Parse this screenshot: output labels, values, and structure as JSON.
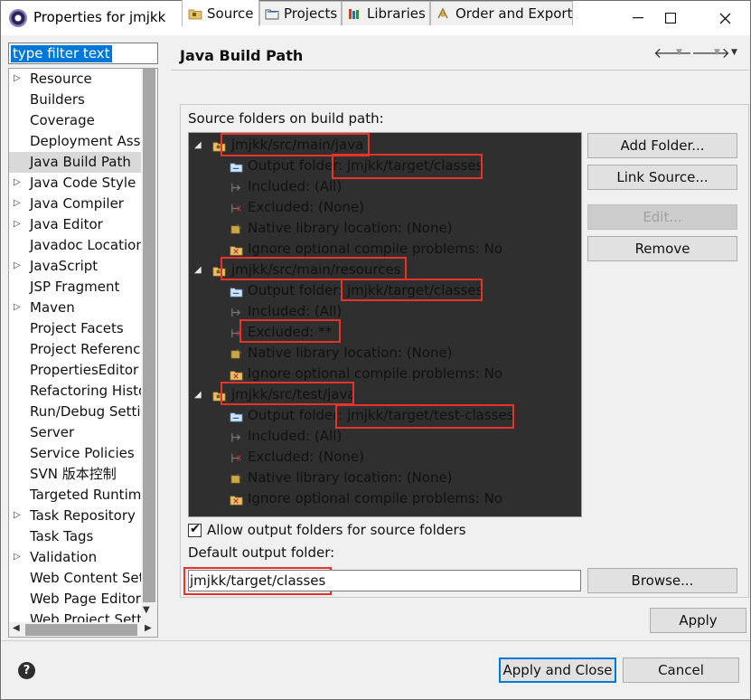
{
  "window": {
    "title": "Properties for jmjkk"
  },
  "filter": {
    "placeholder": "type filter text"
  },
  "nav": {
    "items": [
      {
        "label": "Resource",
        "expandable": true
      },
      {
        "label": "Builders",
        "expandable": false
      },
      {
        "label": "Coverage",
        "expandable": false
      },
      {
        "label": "Deployment Assembly",
        "expandable": false
      },
      {
        "label": "Java Build Path",
        "expandable": false,
        "selected": true
      },
      {
        "label": "Java Code Style",
        "expandable": true
      },
      {
        "label": "Java Compiler",
        "expandable": true
      },
      {
        "label": "Java Editor",
        "expandable": true
      },
      {
        "label": "Javadoc Location",
        "expandable": false
      },
      {
        "label": "JavaScript",
        "expandable": true
      },
      {
        "label": "JSP Fragment",
        "expandable": false
      },
      {
        "label": "Maven",
        "expandable": true
      },
      {
        "label": "Project Facets",
        "expandable": false
      },
      {
        "label": "Project References",
        "expandable": false
      },
      {
        "label": "PropertiesEditor",
        "expandable": false
      },
      {
        "label": "Refactoring History",
        "expandable": false
      },
      {
        "label": "Run/Debug Settings",
        "expandable": false
      },
      {
        "label": "Server",
        "expandable": false
      },
      {
        "label": "Service Policies",
        "expandable": false
      },
      {
        "label": "SVN 版本控制",
        "expandable": false
      },
      {
        "label": "Targeted Runtimes",
        "expandable": false
      },
      {
        "label": "Task Repository",
        "expandable": true
      },
      {
        "label": "Task Tags",
        "expandable": false
      },
      {
        "label": "Validation",
        "expandable": true
      },
      {
        "label": "Web Content Settings",
        "expandable": false
      },
      {
        "label": "Web Page Editor",
        "expandable": false
      },
      {
        "label": "Web Project Settings",
        "expandable": false
      }
    ]
  },
  "page": {
    "title": "Java Build Path"
  },
  "tabs": [
    {
      "label": "Source",
      "active": true
    },
    {
      "label": "Projects"
    },
    {
      "label": "Libraries"
    },
    {
      "label": "Order and Export"
    }
  ],
  "source": {
    "heading": "Source folders on build path:",
    "folders": [
      {
        "name": "jmjkk/src/main/java",
        "children": [
          {
            "label": "Output folder: ",
            "value": "jmjkk/target/classes"
          },
          {
            "label": "Included: (All)"
          },
          {
            "label": "Excluded: (None)"
          },
          {
            "label": "Native library location: (None)"
          },
          {
            "label": "Ignore optional compile problems: No"
          }
        ]
      },
      {
        "name": "jmjkk/src/main/resources",
        "children": [
          {
            "label": "Output folder: ",
            "value": "jmjkk/target/classes"
          },
          {
            "label": "Included: (All)"
          },
          {
            "label": "Excluded: **"
          },
          {
            "label": "Native library location: (None)"
          },
          {
            "label": "Ignore optional compile problems: No"
          }
        ]
      },
      {
        "name": "jmjkk/src/test/java",
        "children": [
          {
            "label": "Output folder: ",
            "value": "jmjkk/target/test-classes"
          },
          {
            "label": "Included: (All)"
          },
          {
            "label": "Excluded: (None)"
          },
          {
            "label": "Native library location: (None)"
          },
          {
            "label": "Ignore optional compile problems: No"
          }
        ]
      }
    ],
    "buttons": {
      "add_folder": "Add Folder...",
      "link_source": "Link Source...",
      "edit": "Edit...",
      "remove": "Remove"
    },
    "allow_output": {
      "label": "Allow output folders for source folders",
      "checked": true
    },
    "default_output": {
      "label": "Default output folder:",
      "value": "jmjkk/target/classes"
    },
    "browse": "Browse..."
  },
  "footer": {
    "apply": "Apply",
    "apply_close": "Apply and Close",
    "cancel": "Cancel",
    "help": "?"
  },
  "colors": {
    "accent": "#0078d7",
    "highlight": "#e8332a",
    "tree_bg": "#2f2f2f"
  }
}
